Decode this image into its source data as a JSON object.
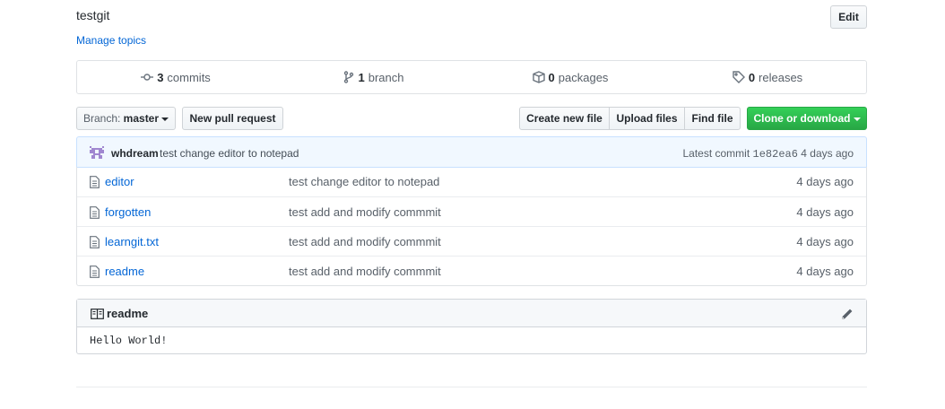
{
  "repo": {
    "description": "testgit",
    "manage_topics": "Manage topics",
    "edit_label": "Edit"
  },
  "numbers": {
    "commits_count": "3",
    "commits_label": "commits",
    "branch_count": "1",
    "branch_label": "branch",
    "packages_count": "0",
    "packages_label": "packages",
    "releases_count": "0",
    "releases_label": "releases"
  },
  "toolbar": {
    "branch_prefix": "Branch:",
    "branch_name": "master",
    "new_pr": "New pull request",
    "create_file": "Create new file",
    "upload_files": "Upload files",
    "find_file": "Find file",
    "clone": "Clone or download"
  },
  "latest_commit": {
    "author": "whdream",
    "message": "test change editor to notepad",
    "label": "Latest commit",
    "sha": "1e82ea6",
    "age": "4 days ago"
  },
  "files": [
    {
      "name": "editor",
      "message": "test change editor to notepad",
      "age": "4 days ago"
    },
    {
      "name": "forgotten",
      "message": "test add and modify commmit",
      "age": "4 days ago"
    },
    {
      "name": "learngit.txt",
      "message": "test add and modify commmit",
      "age": "4 days ago"
    },
    {
      "name": "readme",
      "message": "test add and modify commmit",
      "age": "4 days ago"
    }
  ],
  "readme": {
    "title": "readme",
    "content": "Hello World!"
  },
  "colors": {
    "link": "#0366d6",
    "clone_green": "#28a745",
    "commit_bar_bg": "#f1f8ff",
    "avatar_purple": "#a087d0"
  }
}
